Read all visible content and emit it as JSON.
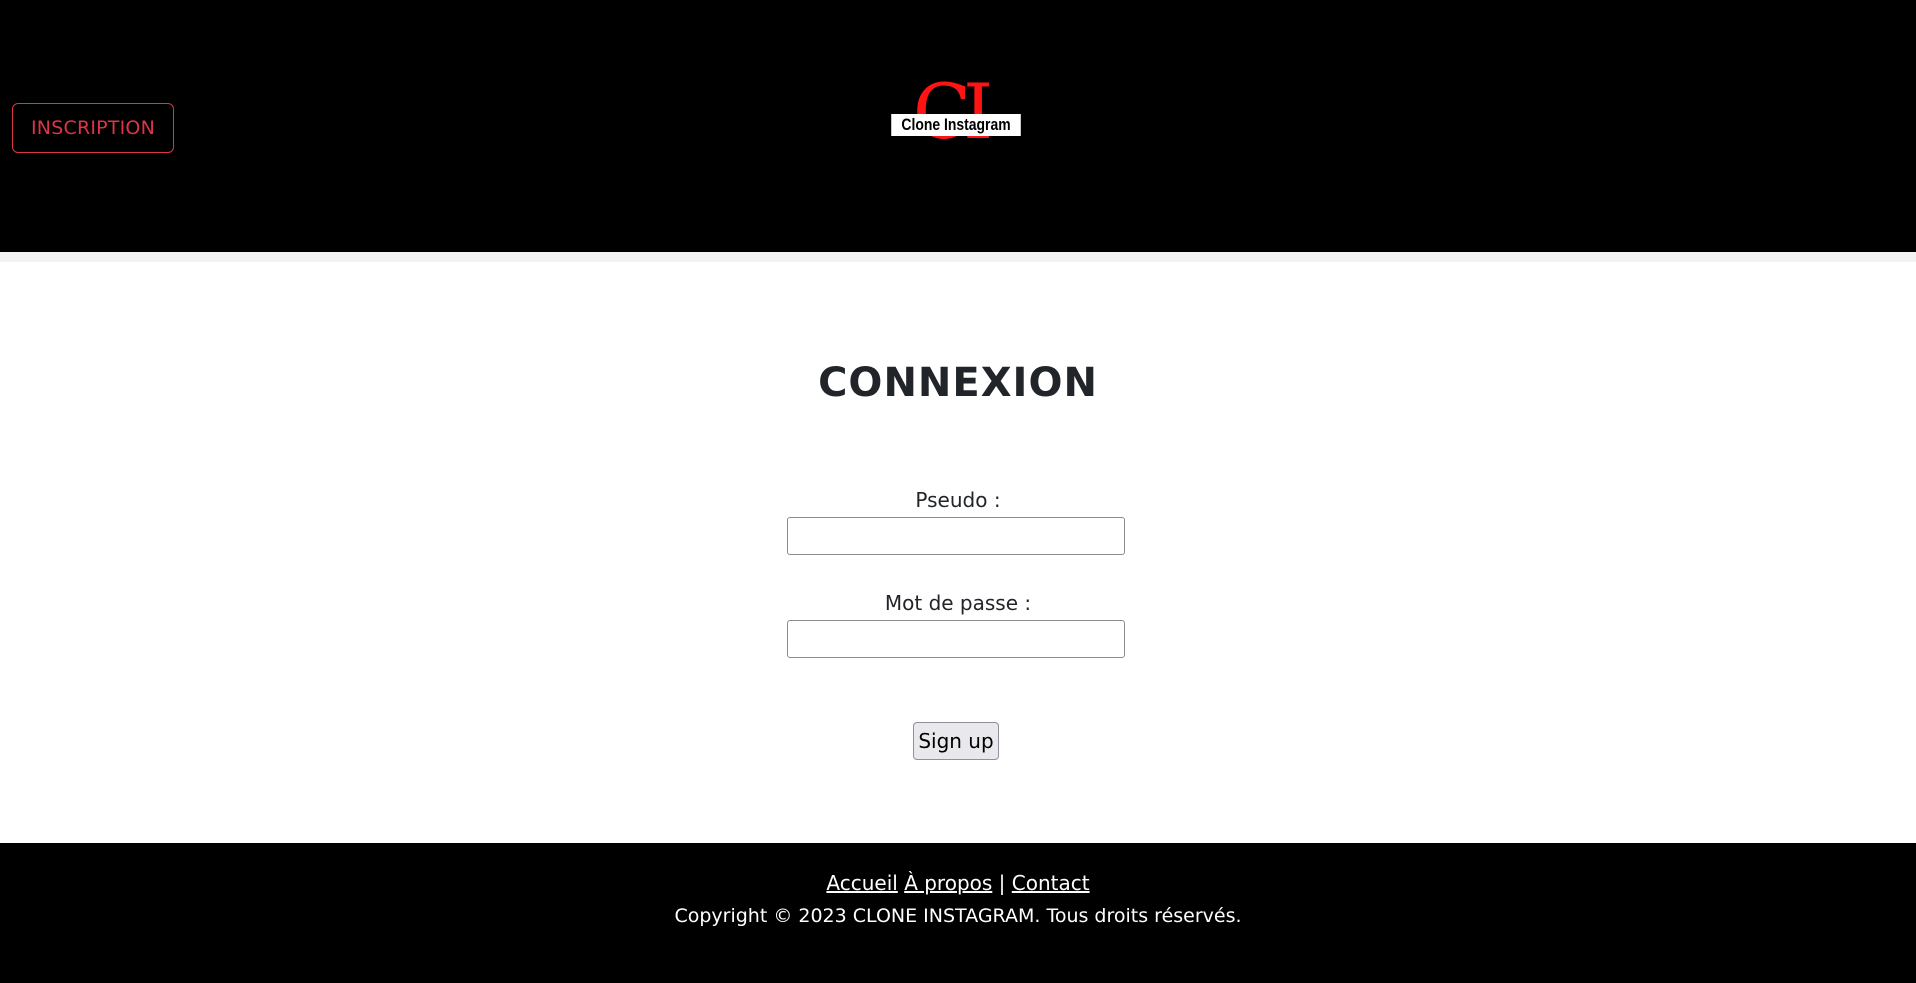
{
  "header": {
    "signup_link": "INSCRIPTION",
    "logo": {
      "mark": "CI",
      "text": "Clone Instagram"
    }
  },
  "main": {
    "title": "CONNEXION",
    "fields": [
      {
        "label": "Pseudo :",
        "value": "",
        "placeholder": ""
      },
      {
        "label": "Mot de passe :",
        "value": "",
        "placeholder": ""
      }
    ],
    "submit_label": "Sign up"
  },
  "footer": {
    "links": [
      {
        "label": "Accueil"
      },
      {
        "label": "À propos"
      },
      {
        "label": "Contact"
      }
    ],
    "separator": "|",
    "copyright": "Copyright © 2023 CLONE INSTAGRAM. Tous droits réservés."
  },
  "colors": {
    "header_bg": "#000000",
    "accent_red": "#dc3545",
    "logo_red": "#ff1414",
    "footer_bg": "#000000"
  }
}
